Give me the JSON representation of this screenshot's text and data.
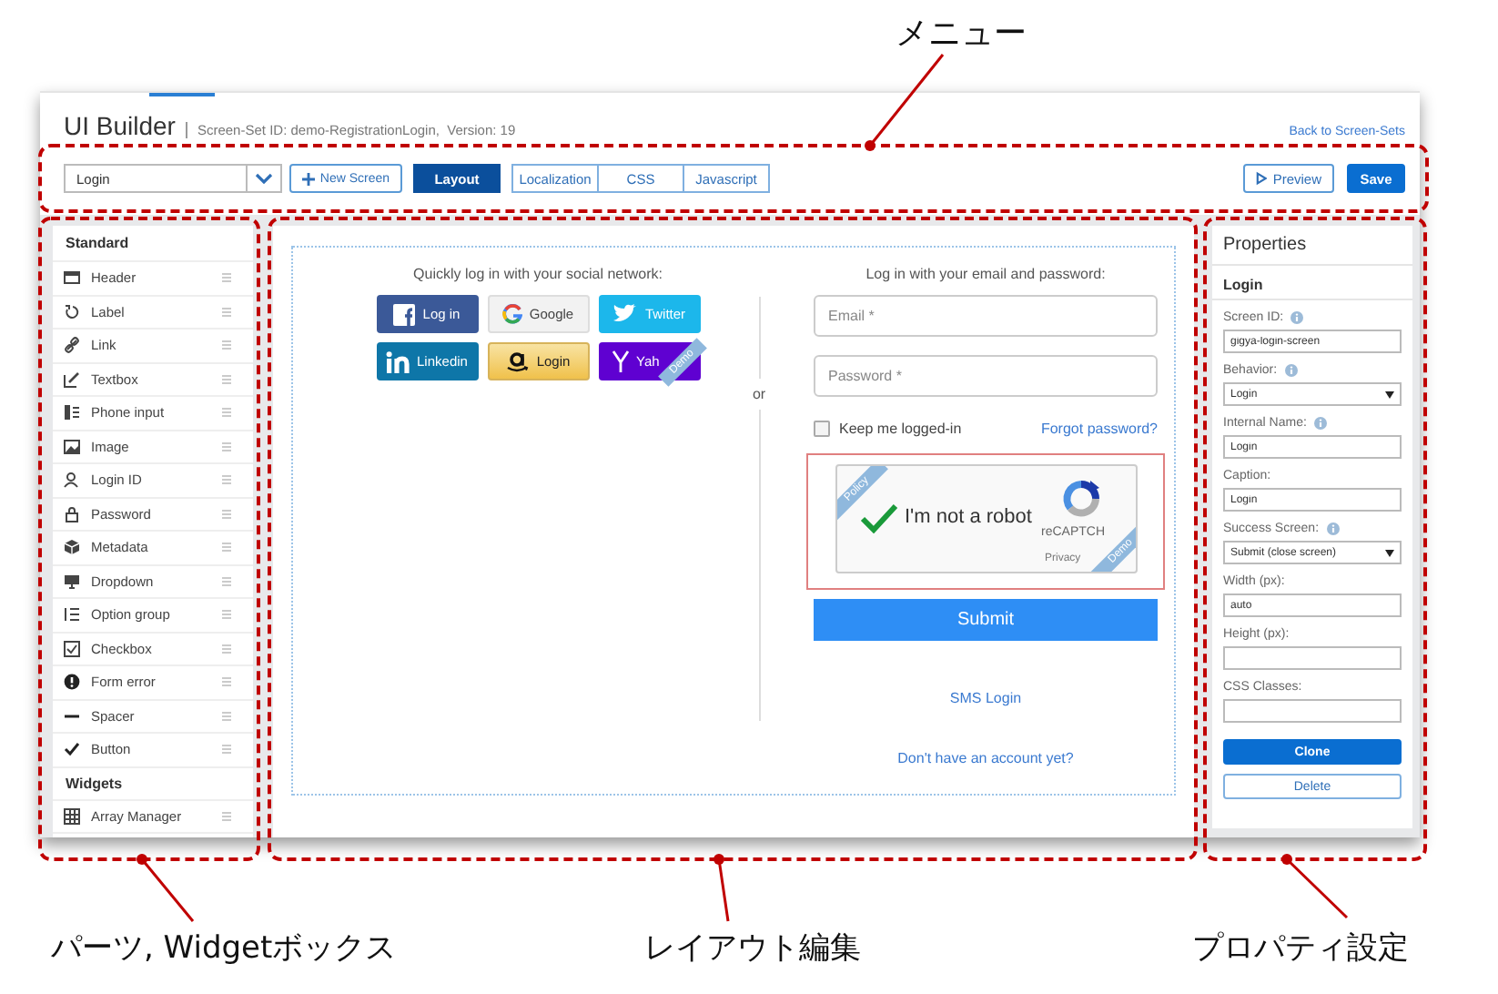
{
  "header": {
    "title": "UI Builder",
    "subtitle": "Screen-Set ID: demo-RegistrationLogin,  Version: 19",
    "back_link": "Back to Screen-Sets"
  },
  "toolbar": {
    "screen_select": "Login",
    "new_screen": "New Screen",
    "tabs": [
      {
        "label": "Layout",
        "selected": true
      },
      {
        "label": "Localization",
        "selected": false
      },
      {
        "label": "CSS",
        "selected": false
      },
      {
        "label": "Javascript",
        "selected": false
      }
    ],
    "preview": "Preview",
    "save": "Save"
  },
  "sidebar": {
    "sections": [
      {
        "title": "Standard",
        "items": [
          "Header",
          "Label",
          "Link",
          "Textbox",
          "Phone input",
          "Image",
          "Login ID",
          "Password",
          "Metadata",
          "Dropdown",
          "Option group",
          "Checkbox",
          "Form error",
          "Spacer",
          "Button"
        ]
      },
      {
        "title": "Widgets",
        "items": [
          "Array Manager"
        ]
      }
    ]
  },
  "canvas": {
    "social": {
      "title": "Quickly log in with your social network:",
      "buttons": [
        {
          "kind": "facebook",
          "label": "Log in"
        },
        {
          "kind": "google",
          "label": "Google"
        },
        {
          "kind": "twitter",
          "label": "Twitter"
        },
        {
          "kind": "linkedin",
          "label": "Linkedin"
        },
        {
          "kind": "amazon",
          "label": "Login"
        },
        {
          "kind": "yahoo",
          "label": "Yah",
          "ribbon": "Demo"
        }
      ]
    },
    "divider": "or",
    "login": {
      "title": "Log in with your email and password:",
      "fields": [
        {
          "placeholder": "Email *"
        },
        {
          "placeholder": "Password *"
        }
      ],
      "remember": {
        "label": "Keep me logged-in",
        "checked": false
      },
      "forgot": "Forgot password?",
      "captcha": {
        "label": "I'm not a robot",
        "checked": true,
        "brand": "reCAPTCH",
        "privacy": "Privacy",
        "ribbons": [
          "Policy",
          "Demo"
        ]
      },
      "submit": "Submit",
      "sms": "SMS Login",
      "signup": "Don't have an account yet?"
    }
  },
  "properties": {
    "title": "Properties",
    "section": "Login",
    "fields": [
      {
        "kind": "text",
        "label": "Screen ID:",
        "info": true,
        "value": "gigya-login-screen"
      },
      {
        "kind": "select",
        "label": "Behavior:",
        "info": true,
        "value": "Login"
      },
      {
        "kind": "text",
        "label": "Internal Name:",
        "info": true,
        "value": "Login"
      },
      {
        "kind": "text",
        "label": "Caption:",
        "info": false,
        "value": "Login"
      },
      {
        "kind": "select",
        "label": "Success Screen:",
        "info": true,
        "value": "Submit (close screen)"
      },
      {
        "kind": "text",
        "label": "Width (px):",
        "info": false,
        "value": "auto"
      },
      {
        "kind": "text",
        "label": "Height (px):",
        "info": false
      },
      {
        "kind": "text",
        "label": "CSS Classes:",
        "info": false
      }
    ],
    "clone": "Clone",
    "delete": "Delete"
  },
  "annotations": [
    {
      "label": "メニュー"
    },
    {
      "label": "パーツ, Widgetボックス"
    },
    {
      "label": "レイアウト編集"
    },
    {
      "label": "プロパティ設定"
    }
  ]
}
